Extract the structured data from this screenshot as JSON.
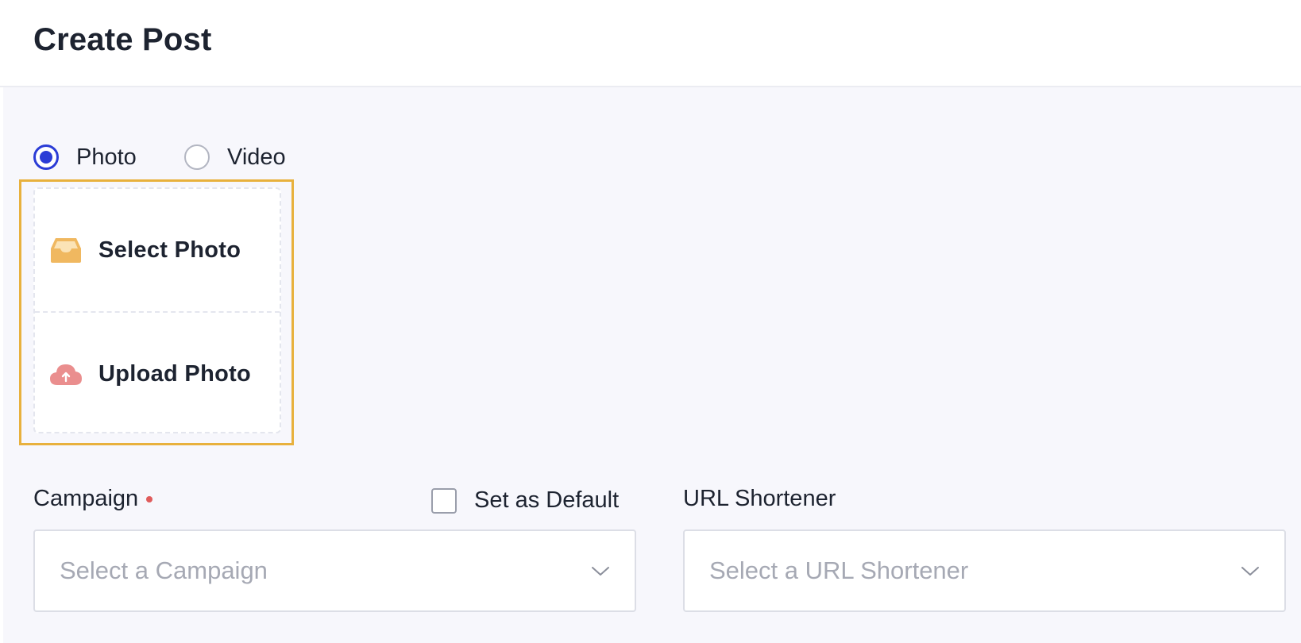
{
  "header": {
    "title": "Create Post"
  },
  "media_type": {
    "options": [
      {
        "label": "Photo",
        "selected": true
      },
      {
        "label": "Video",
        "selected": false
      }
    ]
  },
  "media_panel": {
    "select_label": "Select Photo",
    "upload_label": "Upload Photo",
    "select_icon": "inbox-tray-icon",
    "upload_icon": "cloud-upload-icon",
    "highlight_color": "#e8b13d"
  },
  "campaign": {
    "label": "Campaign",
    "required": true,
    "placeholder": "Select a Campaign"
  },
  "default_checkbox": {
    "label": "Set as Default",
    "checked": false
  },
  "url_shortener": {
    "label": "URL Shortener",
    "placeholder": "Select a URL Shortener"
  },
  "colors": {
    "accent": "#2b3cd6",
    "required": "#e05b5b",
    "select_icon": "#f0b860",
    "upload_icon": "#ea8e8e"
  }
}
